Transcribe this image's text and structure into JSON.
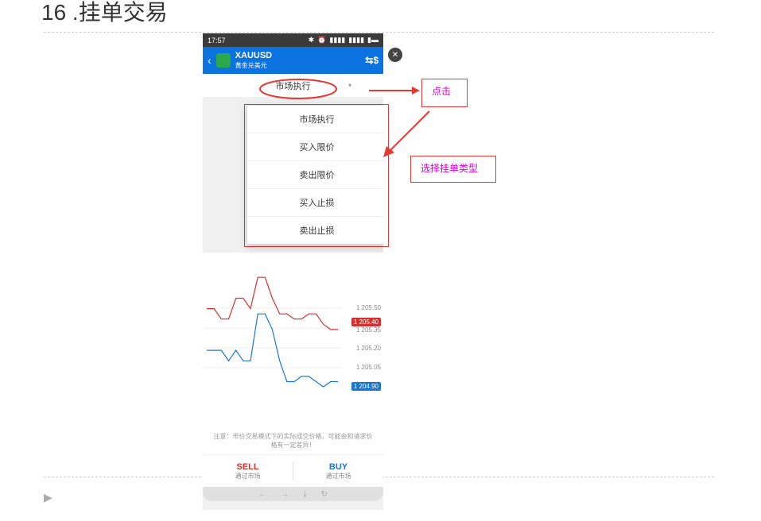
{
  "slide": {
    "title": "16 .挂单交易"
  },
  "statusbar": {
    "time": "17:57",
    "bt_icon": "✱",
    "alarm_icon": "⏰",
    "sig1": "▮▮▮▮",
    "sig2": "▮▮▮▮",
    "battery_icon": "▮▬"
  },
  "appbar": {
    "back_glyph": "‹",
    "symbol": "XAUUSD",
    "subtitle": "黄金兑美元",
    "swap_glyph": "⇆$"
  },
  "order": {
    "selected": "市场执行",
    "options": [
      "市场执行",
      "买入限价",
      "卖出限价",
      "买入止损",
      "卖出止损"
    ]
  },
  "chart_data": {
    "type": "line",
    "title": "",
    "xlabel": "",
    "ylabel": "",
    "ylim": [
      1204.5,
      1206.1
    ],
    "gridlines": [
      1205.5,
      1205.35,
      1205.2,
      1205.05
    ],
    "series": [
      {
        "name": "ask",
        "color": "#d32f2f",
        "values": [
          1205.6,
          1205.6,
          1205.5,
          1205.5,
          1205.7,
          1205.7,
          1205.6,
          1205.9,
          1205.9,
          1205.7,
          1205.55,
          1205.55,
          1205.5,
          1205.5,
          1205.55,
          1205.55,
          1205.45,
          1205.4,
          1205.4
        ],
        "tag": "1 205.40"
      },
      {
        "name": "bid",
        "color": "#1976d2",
        "values": [
          1205.2,
          1205.2,
          1205.2,
          1205.1,
          1205.2,
          1205.1,
          1205.1,
          1205.55,
          1205.55,
          1205.4,
          1205.1,
          1204.9,
          1204.9,
          1204.95,
          1204.95,
          1204.9,
          1204.85,
          1204.9,
          1204.9
        ],
        "tag": "1 204.90"
      }
    ],
    "ytick_labels": [
      "1 205.50",
      "1 205.35",
      "1 205.20",
      "1 205.05"
    ]
  },
  "notice": {
    "text": "注意：市价交易模式下的实际成交价格，可能会和请求价格有一定差异！"
  },
  "actions": {
    "sell_main": "SELL",
    "sell_sub": "通过市场",
    "buy_main": "BUY",
    "buy_sub": "通过市场"
  },
  "navbar": {
    "back_glyph": "←",
    "fwd_glyph": "→",
    "down_glyph": "⤓",
    "refresh_glyph": "↻"
  },
  "close_btn": {
    "glyph": "✕"
  },
  "annotations": {
    "click_label": "点击",
    "select_label": "选择挂单类型"
  }
}
